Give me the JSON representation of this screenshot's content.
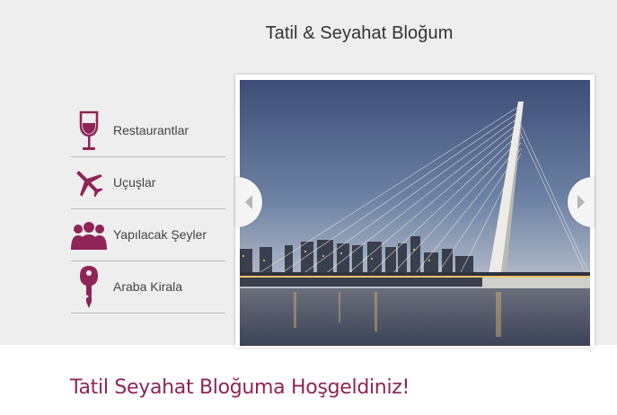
{
  "header": {
    "title": "Tatil & Seyahat Bloğum"
  },
  "menu": {
    "items": [
      {
        "label": "Restaurantlar",
        "icon": "wine-glass-icon"
      },
      {
        "label": "Uçuşlar",
        "icon": "airplane-icon"
      },
      {
        "label": "Yapılacak Şeyler",
        "icon": "people-icon"
      },
      {
        "label": "Araba Kirala",
        "icon": "key-icon"
      }
    ]
  },
  "slider": {
    "image": "cable-stayed-bridge-city-skyline-dusk",
    "prev_icon": "chevron-left-icon",
    "next_icon": "chevron-right-icon"
  },
  "main": {
    "welcome": "Tatil Seyahat Bloğuma Hoşgeldiniz!"
  },
  "colors": {
    "accent": "#8f2457",
    "band": "#efeeee"
  }
}
